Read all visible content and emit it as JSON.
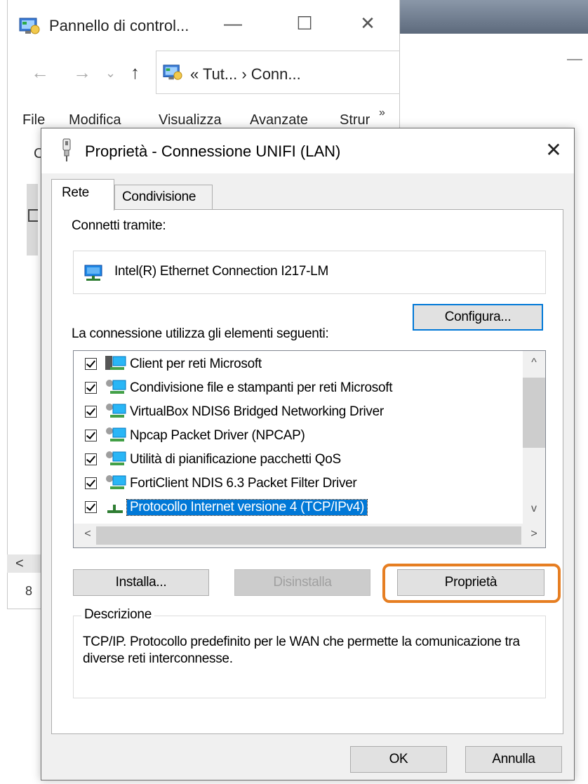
{
  "explorer": {
    "title": "Pannello di control...",
    "controls": {
      "minimize": "—",
      "maximize": "☐",
      "close": "✕"
    },
    "nav": {
      "back": "←",
      "forward": "→",
      "recent": "⌄",
      "up": "↑"
    },
    "address": "« Tut... › Conn...",
    "menu": [
      "File",
      "Modifica",
      "Visualizza",
      "Avanzate",
      "Strur"
    ],
    "menu_more": "»",
    "left_fragment": "C",
    "scroll_left": "<",
    "status_fragment": "8"
  },
  "dialog": {
    "title": "Proprietà - Connessione UNIFI (LAN)",
    "close": "✕",
    "tabs": [
      {
        "label": "Rete",
        "active": true
      },
      {
        "label": "Condivisione",
        "active": false
      }
    ],
    "connect_via_label": "Connetti tramite:",
    "adapter_name": "Intel(R) Ethernet Connection I217-LM",
    "configure_button": "Configura...",
    "items_label": "La connessione utilizza gli elementi seguenti:",
    "items": [
      {
        "label": "Client per reti Microsoft",
        "checked": true,
        "icon": "network-client-icon"
      },
      {
        "label": "Condivisione file e stampanti per reti Microsoft",
        "checked": true,
        "icon": "network-service-icon"
      },
      {
        "label": "VirtualBox NDIS6 Bridged Networking Driver",
        "checked": true,
        "icon": "network-service-icon"
      },
      {
        "label": "Npcap Packet Driver (NPCAP)",
        "checked": true,
        "icon": "network-service-icon"
      },
      {
        "label": "Utilità di pianificazione pacchetti QoS",
        "checked": true,
        "icon": "network-service-icon"
      },
      {
        "label": "FortiClient NDIS 6.3 Packet Filter Driver",
        "checked": true,
        "icon": "network-service-icon"
      },
      {
        "label": "Protocollo Internet versione 4 (TCP/IPv4)",
        "checked": true,
        "icon": "protocol-icon",
        "selected": true
      }
    ],
    "scroll": {
      "up": "^",
      "down": "v",
      "left": "<",
      "right": ">"
    },
    "install_button": "Installa...",
    "uninstall_button": "Disinstalla",
    "properties_button": "Proprietà",
    "description_legend": "Descrizione",
    "description_text": "TCP/IP. Protocollo predefinito per le WAN che permette la comunicazione tra diverse reti interconnesse.",
    "ok_button": "OK",
    "cancel_button": "Annulla"
  },
  "colors": {
    "selection": "#0078d7",
    "highlight_annotation": "#e67e22",
    "dialog_bg": "#f0f0f0"
  }
}
